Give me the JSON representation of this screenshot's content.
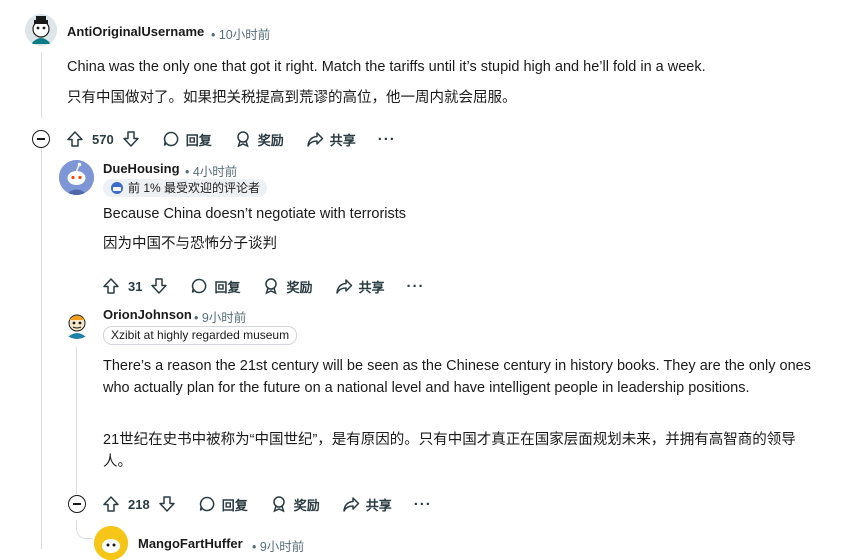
{
  "comments": [
    {
      "username": "AntiOriginalUsername",
      "time": "• 10小时前",
      "text_en": "China was the only one that got it right. Match the tariffs until it’s stupid high and he’ll fold in a week.",
      "text_zh": "只有中国做对了。如果把关税提高到荒谬的高位，他一周内就会屈服。",
      "votes": "570"
    },
    {
      "username": "DueHousing",
      "time": "• 4小时前",
      "flair": "前 1% 最受欢迎的评论者",
      "text_en": "Because China doesn’t negotiate with terrorists",
      "text_zh": "因为中国不与恐怖分子谈判",
      "votes": "31"
    },
    {
      "username": "OrionJohnson",
      "time": "• 9小时前",
      "flair": "Xzibit at highly regarded museum",
      "text_en": "There’s a reason the 21st century will be seen as the Chinese century in history books. They are the only ones who actually plan for the future on a national level and have intelligent people in leadership positions.",
      "text_zh": "21世纪在史书中被称为“中国世纪”，是有原因的。只有中国才真正在国家层面规划未来，并拥有高智商的领导人。",
      "votes": "218"
    },
    {
      "username": "MangoFartHuffer",
      "time": "• 9小时前"
    }
  ],
  "actions": {
    "reply": "回复",
    "award": "奖励",
    "share": "共享",
    "more": "···"
  },
  "icons": [
    "upvote-icon",
    "downvote-icon",
    "comment-icon",
    "award-icon",
    "share-icon",
    "more-icon",
    "collapse-icon",
    "avatar"
  ]
}
